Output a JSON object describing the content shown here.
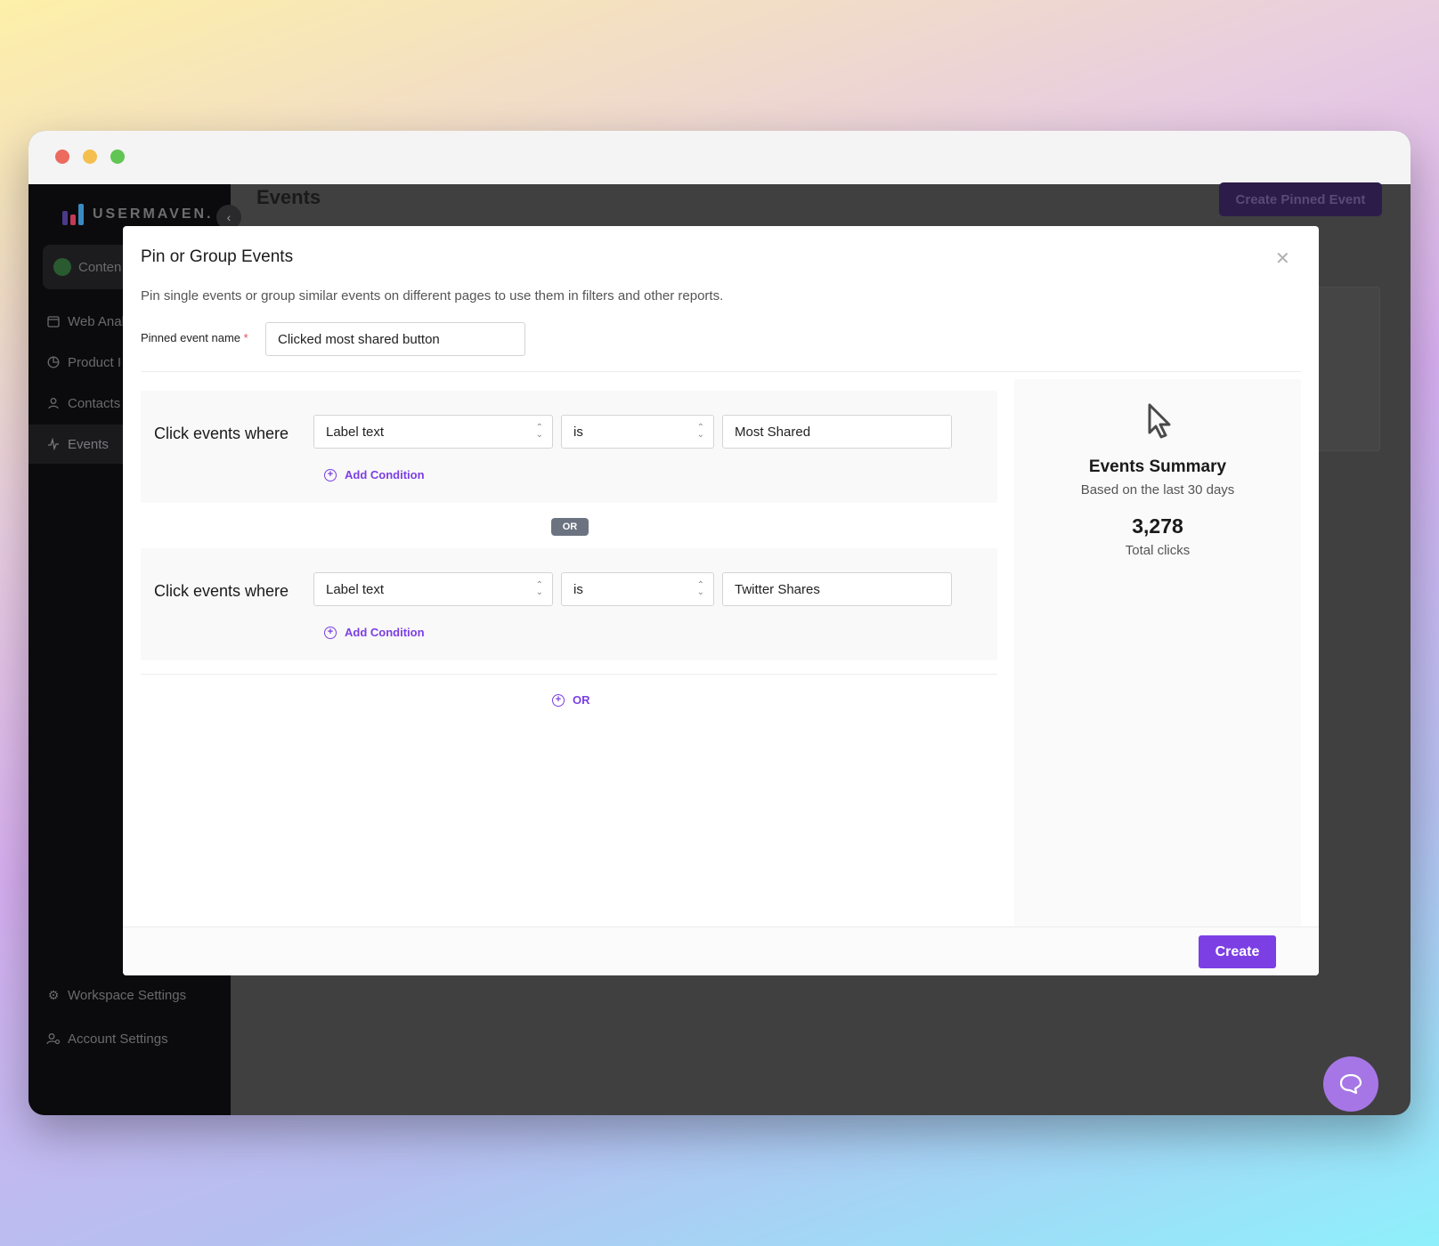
{
  "sidebar": {
    "brand": "USERMAVEN.",
    "brand_colors": [
      "#4b3a8a",
      "#c23a55",
      "#3a8ac2"
    ],
    "workspace": "Conten",
    "items": [
      {
        "label": "Web Anal",
        "icon": "calendar-icon"
      },
      {
        "label": "Product I",
        "icon": "pie-chart-icon"
      },
      {
        "label": "Contacts",
        "icon": "user-icon"
      },
      {
        "label": "Events",
        "icon": "activity-icon"
      }
    ],
    "bottom_items": [
      {
        "label": "Workspace Settings",
        "icon": "gear-icon"
      },
      {
        "label": "Account Settings",
        "icon": "user-settings-icon"
      }
    ]
  },
  "header": {
    "title": "Events",
    "create_pinned_label": "Create Pinned Event"
  },
  "modal": {
    "title": "Pin or Group Events",
    "description": "Pin single events or group similar events on different pages to use them in filters and other reports.",
    "name_label": "Pinned event name",
    "required_mark": "*",
    "name_value": "Clicked most shared button",
    "groups": [
      {
        "label": "Click events where",
        "field": "Label text",
        "operator": "is",
        "value": "Most Shared",
        "add_condition": "Add Condition"
      },
      {
        "label": "Click events where",
        "field": "Label text",
        "operator": "is",
        "value": "Twitter Shares",
        "add_condition": "Add Condition"
      }
    ],
    "or_badge": "OR",
    "add_or_label": "OR",
    "summary": {
      "title": "Events Summary",
      "subtitle": "Based on the last 30 days",
      "value": "3,278",
      "value_label": "Total clicks"
    },
    "create_label": "Create"
  },
  "colors": {
    "accent": "#7b3fe4",
    "or_badge": "#6c7380",
    "chat": "#a676e6"
  }
}
